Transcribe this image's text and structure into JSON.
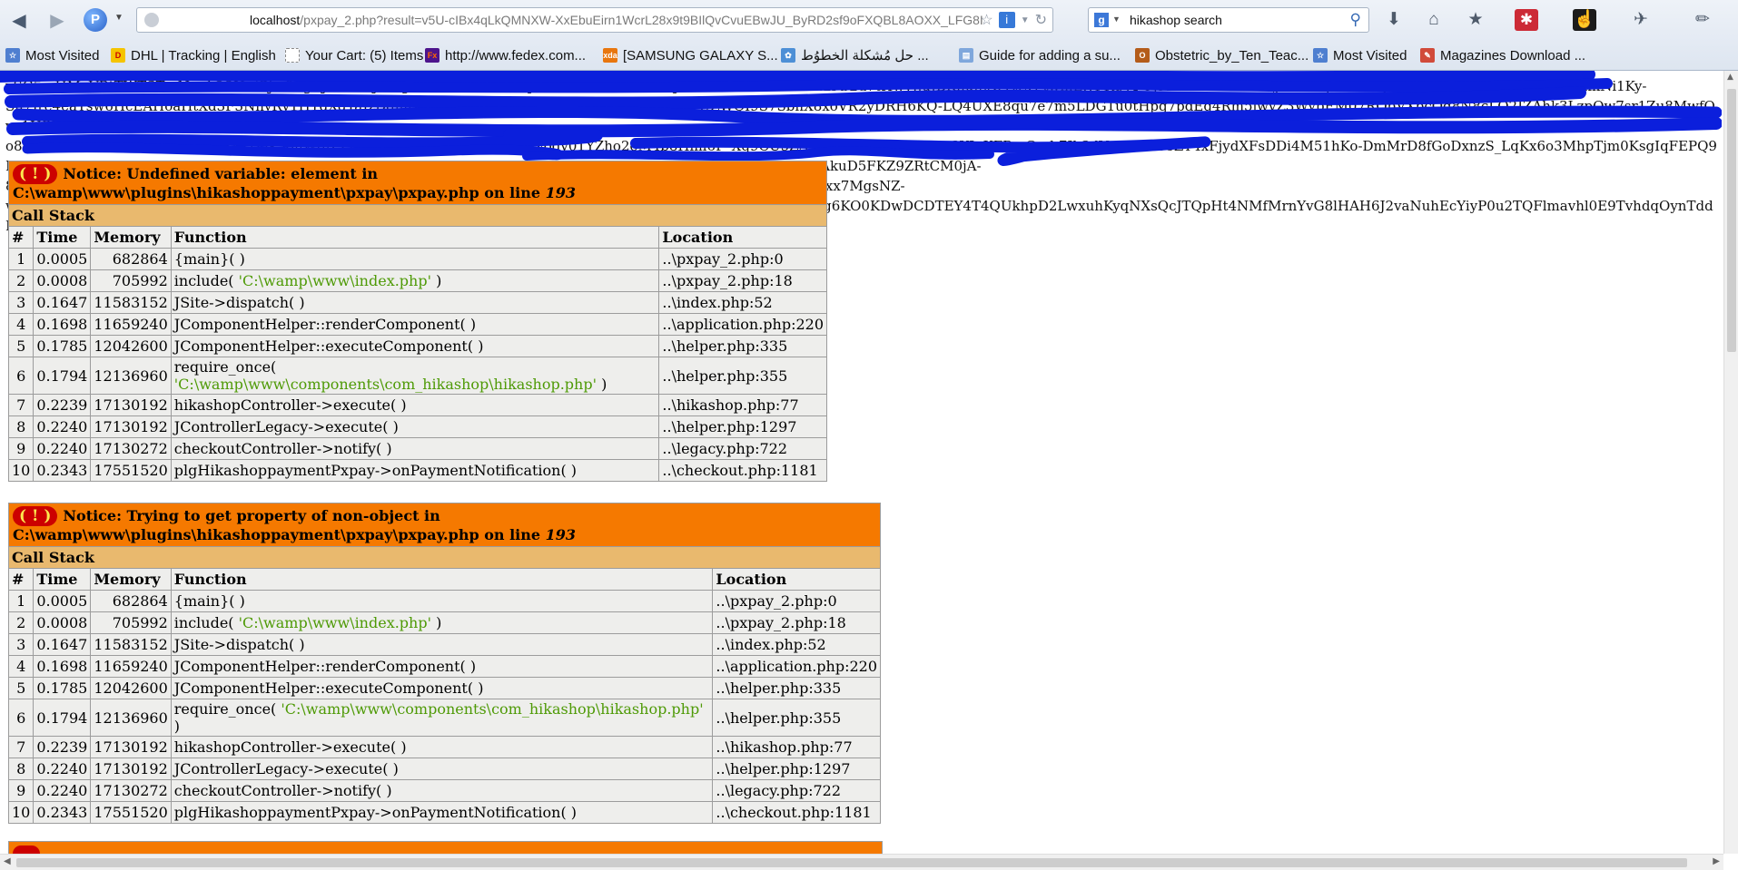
{
  "browser": {
    "url_host": "localhost",
    "url_path": "/pxpay_2.php?result=v5U-cIBx4qLkQMNXW-XxEbuEirn1WcrL28x9t9BIlQvCvuEBwJU_ByRD2sf9oFXQBL8AOXX_LFG8I",
    "search_query": "hikashop search",
    "icons": [
      "back-arrow",
      "forward-arrow",
      "firefox-logo",
      "globe",
      "star",
      "info",
      "refresh",
      "google",
      "search",
      "download",
      "home",
      "bookmark",
      "addon",
      "cursor",
      "tools"
    ]
  },
  "bookmarks": [
    {
      "label": "Most Visited",
      "icon": "most-visited-icon",
      "color": "#4f7fd0"
    },
    {
      "label": "DHL | Tracking | English",
      "icon": "dhl-icon",
      "color": "#f5c400"
    },
    {
      "label": "Your Cart: (5) Items",
      "icon": "cart-icon",
      "color": "#ffffff"
    },
    {
      "label": "http://www.fedex.com...",
      "icon": "fedex-icon",
      "color": "#4d148c"
    },
    {
      "label": "[SAMSUNG GALAXY S...",
      "icon": "xda-icon",
      "color": "#e8760e"
    },
    {
      "label": "حل مُشكلة الخطوُط ...",
      "icon": "paw-icon",
      "color": "#4d8fd6"
    },
    {
      "label": "Guide for adding a su...",
      "icon": "doc-icon",
      "color": "#7fa7dc"
    },
    {
      "label": "Obstetric_by_Ten_Teac...",
      "icon": "wiki-icon",
      "color": "#b45c1a"
    },
    {
      "label": "Most Visited",
      "icon": "most-visited-icon",
      "color": "#4f7fd0"
    },
    {
      "label": "Magazines Download ...",
      "icon": "pen-icon",
      "color": "#d14a3a"
    }
  ],
  "garbled_text": [
    "ySG5mHMaVBtTWTSTmNnr1O3Hv/Gjm2hgBJZbU4zJdLfgf1oKx8OHr1HAPpZa6vHwUoo07n6T1JEvd6WzRuXV2Gr5ut2l-b2u7tHwvJjuJBKnuh0UYtLyPtwmLWPRgVPOjsTm62s7bPe5lk9j0YHTkpLcLvnQR5CdWWcVx9jUoH7DZp1PmkNi1Ky-",
    "Su7Jre4eaYsw6HcEAHoaHtXd3F3NnyRv1HYdXdYaJzDgmtHLzALmVd4u7mvUgCfKfY51A8lj9EUgoTUZWQI9S7SbhX8xoVR2yDRH6KQ-LQ4UXE8qu7e7m5LDG1u0tHpq7pdEg4Rm5jwvZ3WypEM07RQbVXpcQq8N8cLQ2JZAhk3LzpOw7sr1Zu8MwfQvo1HPKOhOe9z0b-",
    "o8eMAt2zHrAV72Zz4q6pT1mVRk1Dqk58nWqlZZicOO3MZApxOfCp9enCaI3Vodv01YZho2eM4b8Hlm6P_Xq9CU5ZA9YYZQiT1nSmuN9m3YJpKFPrsCyrb7Jb3dVz0I6eCo8ZY4xFjydXFsDDi4M51hKo-DmMrD8fGoDxnzS_LqKx6o3MhpTjm0KsgIqFEPQ9Lnwj6yQq8Y76bFXwDluMTMrUs0FRqrQ9PBPdEIeH0vhEupNRCwFELoFAPm3qxvUSRdZqAOYKbY6FUd5gR1XN7mTAkuD5FKZ9ZRtCM0jA-",
    "8887Rma2Jbl6WzvsEGnLgo1HOjnsGoolS4UNXl2m3sZ0Ag95JRgRHpQoWGDT7Cf6kEH8Kp8L6ygtTCpzk6vMxwFp3Zbxx7MgsNZ-",
    "wSwsxXPkG9Iz4wVEyA5hXLVTQUmrPM0LUMPNyRZ3xWjTdbNqXQSbN37kk8cbzN75TiHiGu0wdrTEvpRgjpzqlpwokrg6KO0KDwDCDTEY4T4QUkhpD2LwxuhKyqNXsQcJTQpHt4NMfMrnYvG8lHAH6J2vaNuhEcYiyP0u2TQFlmavhl0E9TvhdqOynTddMqU9XLOMiVJbwQnc="
  ],
  "errors": [
    {
      "notice": "Notice: Undefined variable: element in C:\\wamp\\www\\plugins\\hikashoppayment\\pxpay\\pxpay.php on line ",
      "line": "193",
      "call_stack_label": "Call Stack",
      "headers": [
        "#",
        "Time",
        "Memory",
        "Function",
        "Location"
      ],
      "rows": [
        {
          "n": "1",
          "time": "0.0005",
          "memory": "682864",
          "func": "{main}( )",
          "arg": "",
          "tail": "",
          "loc": "..\\pxpay_2.php:0"
        },
        {
          "n": "2",
          "time": "0.0008",
          "memory": "705992",
          "func": "include( ",
          "arg": "'C:\\wamp\\www\\index.php'",
          "tail": " )",
          "loc": "..\\pxpay_2.php:18"
        },
        {
          "n": "3",
          "time": "0.1647",
          "memory": "11583152",
          "func": "JSite->dispatch( )",
          "arg": "",
          "tail": "",
          "loc": "..\\index.php:52"
        },
        {
          "n": "4",
          "time": "0.1698",
          "memory": "11659240",
          "func": "JComponentHelper::renderComponent( )",
          "arg": "",
          "tail": "",
          "loc": "..\\application.php:220"
        },
        {
          "n": "5",
          "time": "0.1785",
          "memory": "12042600",
          "func": "JComponentHelper::executeComponent( )",
          "arg": "",
          "tail": "",
          "loc": "..\\helper.php:335"
        },
        {
          "n": "6",
          "time": "0.1794",
          "memory": "12136960",
          "func": "require_once( ",
          "arg": "'C:\\wamp\\www\\components\\com_hikashop\\hikashop.php'",
          "tail": " )",
          "loc": "..\\helper.php:355"
        },
        {
          "n": "7",
          "time": "0.2239",
          "memory": "17130192",
          "func": "hikashopController->execute( )",
          "arg": "",
          "tail": "",
          "loc": "..\\hikashop.php:77"
        },
        {
          "n": "8",
          "time": "0.2240",
          "memory": "17130192",
          "func": "JControllerLegacy->execute( )",
          "arg": "",
          "tail": "",
          "loc": "..\\helper.php:1297"
        },
        {
          "n": "9",
          "time": "0.2240",
          "memory": "17130272",
          "func": "checkoutController->notify( )",
          "arg": "",
          "tail": "",
          "loc": "..\\legacy.php:722"
        },
        {
          "n": "10",
          "time": "0.2343",
          "memory": "17551520",
          "func": "plgHikashoppaymentPxpay->onPaymentNotification( )",
          "arg": "",
          "tail": "",
          "loc": "..\\checkout.php:1181"
        }
      ]
    },
    {
      "notice": "Notice: Trying to get property of non-object in C:\\wamp\\www\\plugins\\hikashoppayment\\pxpay\\pxpay.php on line ",
      "line": "193",
      "call_stack_label": "Call Stack",
      "headers": [
        "#",
        "Time",
        "Memory",
        "Function",
        "Location"
      ],
      "rows": [
        {
          "n": "1",
          "time": "0.0005",
          "memory": "682864",
          "func": "{main}( )",
          "arg": "",
          "tail": "",
          "loc": "..\\pxpay_2.php:0"
        },
        {
          "n": "2",
          "time": "0.0008",
          "memory": "705992",
          "func": "include( ",
          "arg": "'C:\\wamp\\www\\index.php'",
          "tail": " )",
          "loc": "..\\pxpay_2.php:18"
        },
        {
          "n": "3",
          "time": "0.1647",
          "memory": "11583152",
          "func": "JSite->dispatch( )",
          "arg": "",
          "tail": "",
          "loc": "..\\index.php:52"
        },
        {
          "n": "4",
          "time": "0.1698",
          "memory": "11659240",
          "func": "JComponentHelper::renderComponent( )",
          "arg": "",
          "tail": "",
          "loc": "..\\application.php:220"
        },
        {
          "n": "5",
          "time": "0.1785",
          "memory": "12042600",
          "func": "JComponentHelper::executeComponent( )",
          "arg": "",
          "tail": "",
          "loc": "..\\helper.php:335"
        },
        {
          "n": "6",
          "time": "0.1794",
          "memory": "12136960",
          "func": "require_once( ",
          "arg": "'C:\\wamp\\www\\components\\com_hikashop\\hikashop.php'",
          "tail": " )",
          "loc": "..\\helper.php:355"
        },
        {
          "n": "7",
          "time": "0.2239",
          "memory": "17130192",
          "func": "hikashopController->execute( )",
          "arg": "",
          "tail": "",
          "loc": "..\\hikashop.php:77"
        },
        {
          "n": "8",
          "time": "0.2240",
          "memory": "17130192",
          "func": "JControllerLegacy->execute( )",
          "arg": "",
          "tail": "",
          "loc": "..\\helper.php:1297"
        },
        {
          "n": "9",
          "time": "0.2240",
          "memory": "17130272",
          "func": "checkoutController->notify( )",
          "arg": "",
          "tail": "",
          "loc": "..\\legacy.php:722"
        },
        {
          "n": "10",
          "time": "0.2343",
          "memory": "17551520",
          "func": "plgHikashoppaymentPxpay->onPaymentNotification( )",
          "arg": "",
          "tail": "",
          "loc": "..\\checkout.php:1181"
        }
      ]
    }
  ],
  "colors": {
    "notice_bg": "#f57900",
    "callstack_bg": "#e9b96e",
    "table_bg": "#eeeeec",
    "path_string": "#4e9a06",
    "redaction": "#0b1fdc"
  }
}
